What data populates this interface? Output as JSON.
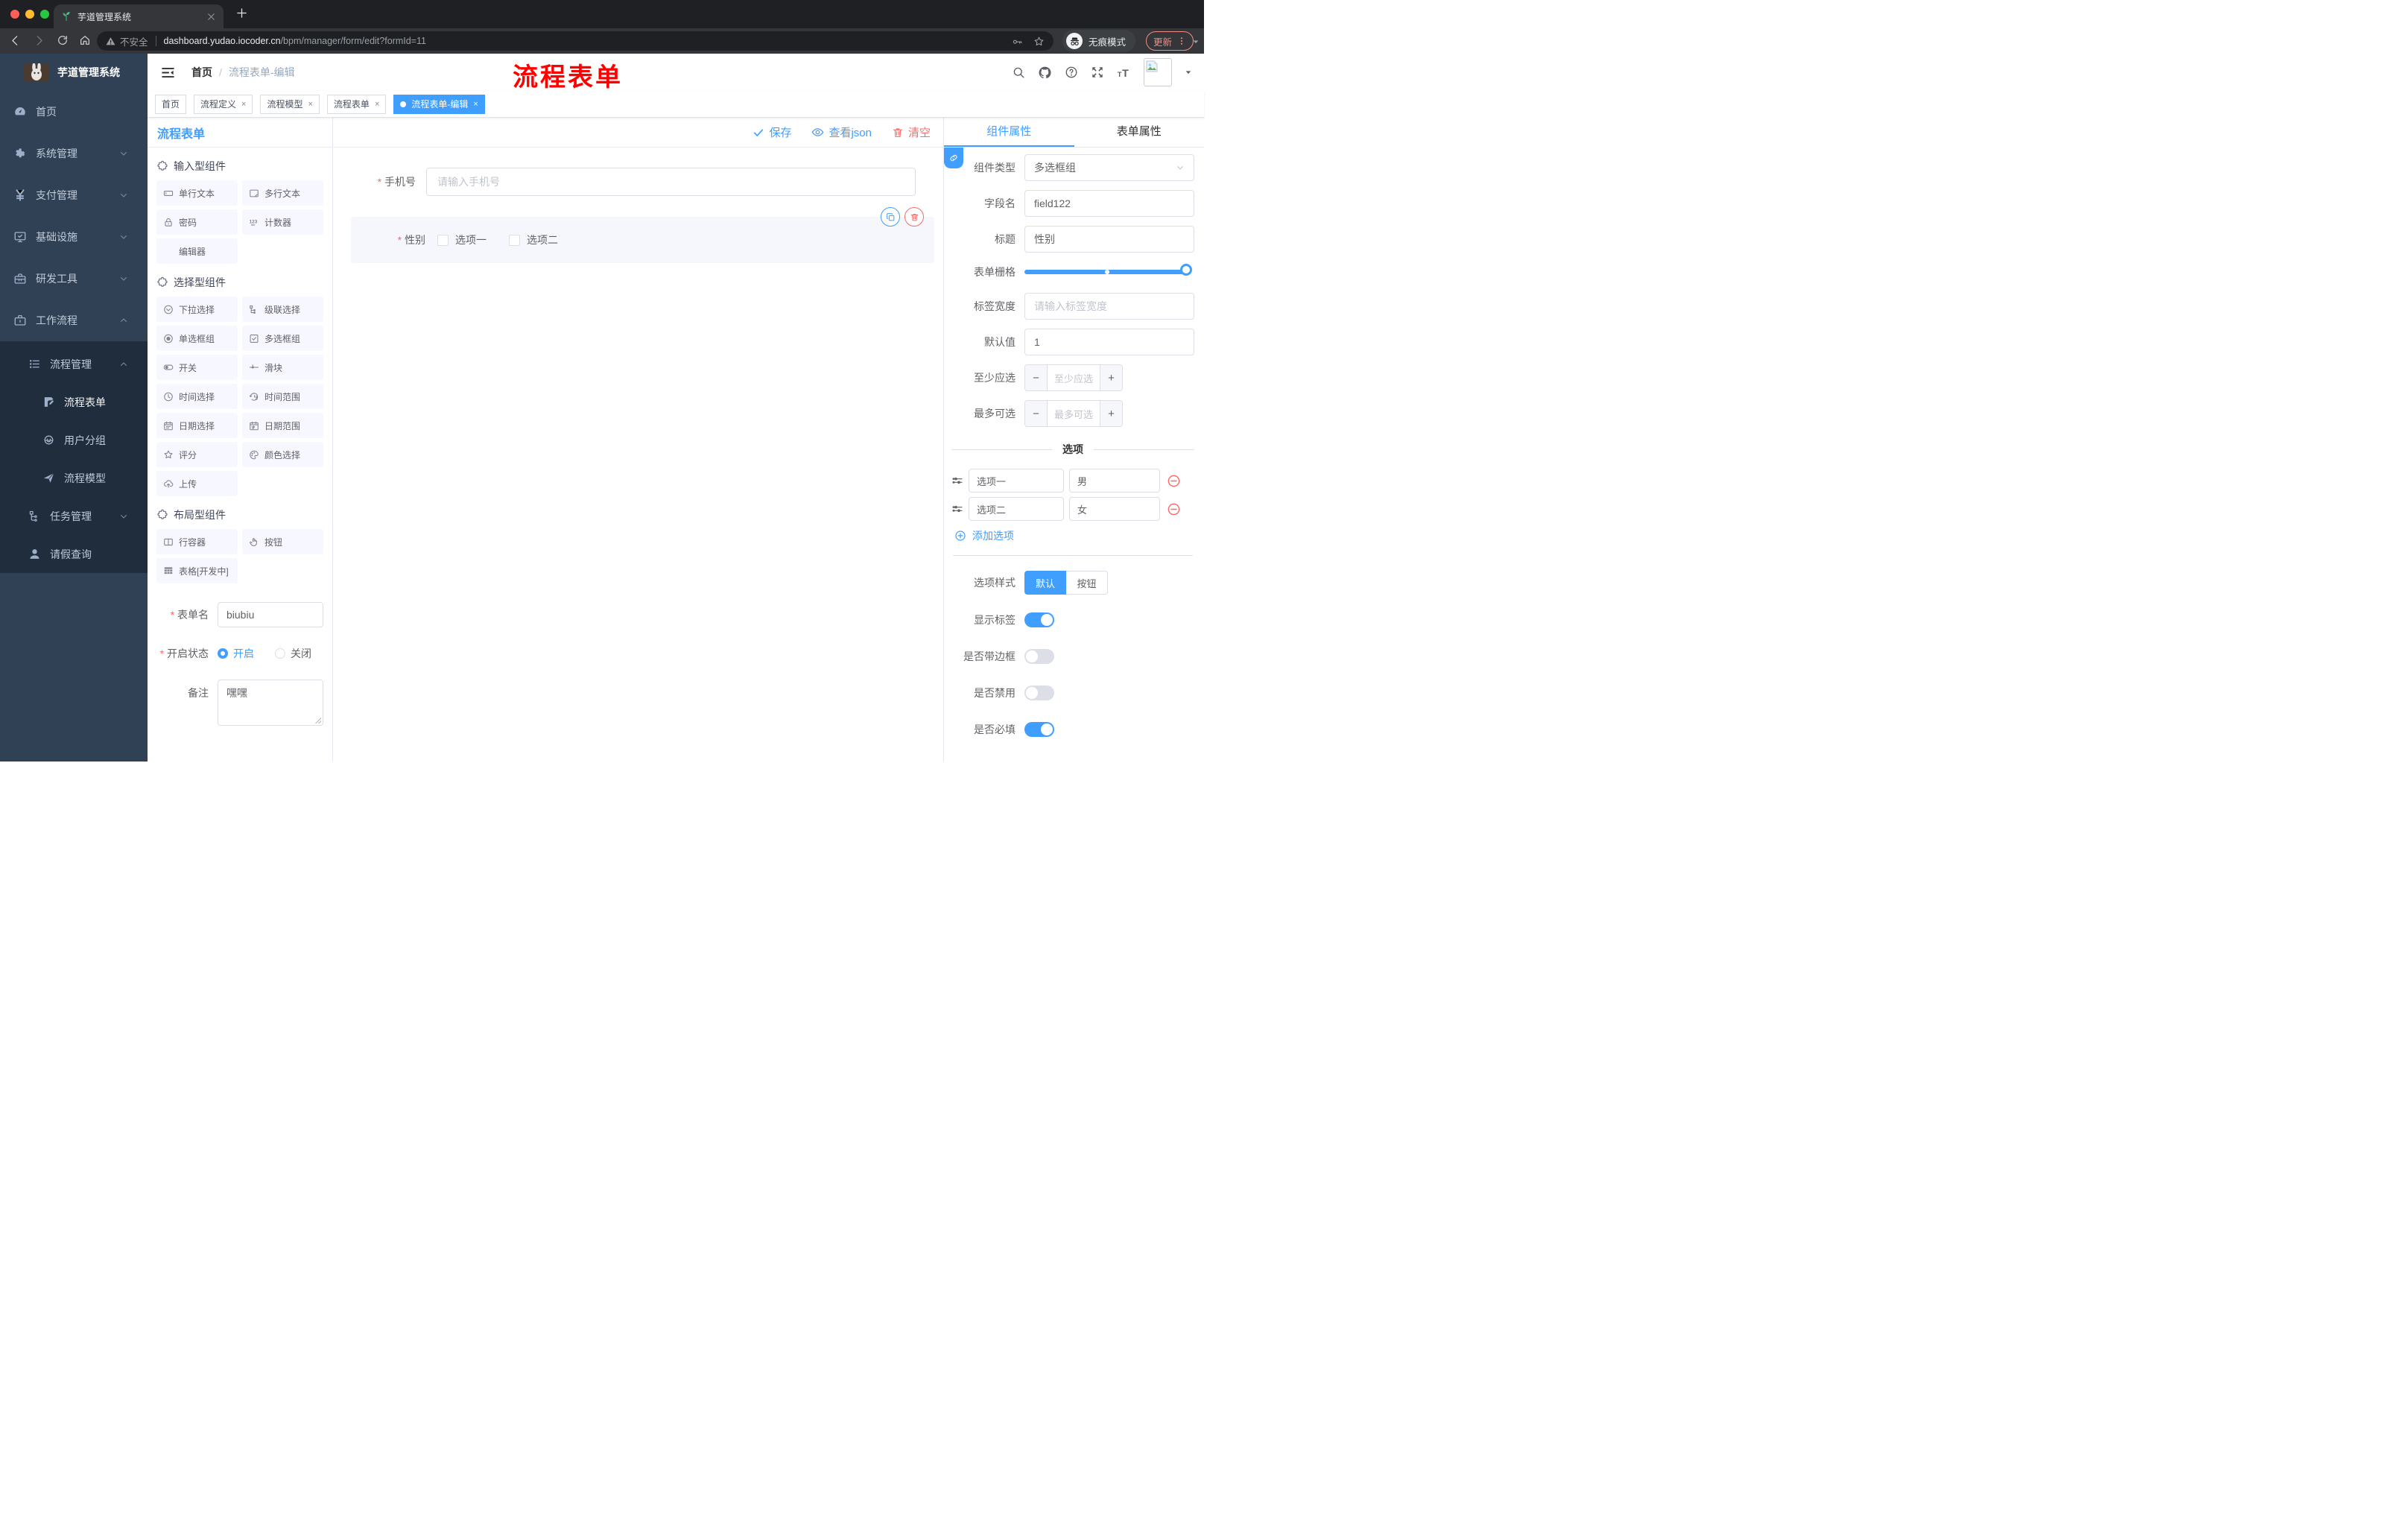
{
  "colors": {
    "accent": "#409eff",
    "danger": "#f56c6c",
    "watermark": "#ff0000",
    "sidebar_bg": "#304156",
    "submenu_bg": "#1f2d3d",
    "active_tag_bg": "#409eff"
  },
  "browser": {
    "tab_title": "芋道管理系统",
    "security_label": "不安全",
    "url_host": "dashboard.yudao.iocoder.cn",
    "url_path": "/bpm/manager/form/edit?formId=11",
    "incognito_label": "无痕模式",
    "update_label": "更新"
  },
  "sidebar": {
    "app_title": "芋道管理系统",
    "items": [
      {
        "label": "首页",
        "icon": "dashboard-icon",
        "chevron": null
      },
      {
        "label": "系统管理",
        "icon": "gear-icon",
        "chevron": "down"
      },
      {
        "label": "支付管理",
        "icon": "yen-icon",
        "chevron": "down"
      },
      {
        "label": "基础设施",
        "icon": "monitor-icon",
        "chevron": "down"
      },
      {
        "label": "研发工具",
        "icon": "toolbox-icon",
        "chevron": "down"
      },
      {
        "label": "工作流程",
        "icon": "briefcase-icon",
        "chevron": "up"
      }
    ],
    "submenu": [
      {
        "label": "流程管理",
        "icon": "list-tree-icon",
        "chevron": "up",
        "level": 2,
        "active": false
      },
      {
        "label": "流程表单",
        "icon": "form-doc-icon",
        "chevron": null,
        "level": 3,
        "active": true
      },
      {
        "label": "用户分组",
        "icon": "group-face-icon",
        "chevron": null,
        "level": 3,
        "active": false
      },
      {
        "label": "流程模型",
        "icon": "send-icon",
        "chevron": null,
        "level": 3,
        "active": false
      },
      {
        "label": "任务管理",
        "icon": "org-tree-icon",
        "chevron": "down",
        "level": 2,
        "active": false
      },
      {
        "label": "请假查询",
        "icon": "user-icon",
        "chevron": null,
        "level": 2,
        "active": false
      }
    ]
  },
  "header": {
    "breadcrumb_home": "首页",
    "breadcrumb_sep": "/",
    "breadcrumb_current": "流程表单-编辑",
    "watermark": "流程表单"
  },
  "tags": [
    {
      "label": "首页",
      "closable": false,
      "active": false
    },
    {
      "label": "流程定义",
      "closable": true,
      "active": false
    },
    {
      "label": "流程模型",
      "closable": true,
      "active": false
    },
    {
      "label": "流程表单",
      "closable": true,
      "active": false
    },
    {
      "label": "流程表单-编辑",
      "closable": true,
      "active": true
    }
  ],
  "designer": {
    "panel_title": "流程表单",
    "toolbar": {
      "save": "保存",
      "view_json": "查看json",
      "clear": "清空"
    },
    "sections": [
      {
        "title": "输入型组件",
        "items": [
          {
            "label": "单行文本",
            "icon": "input-icon"
          },
          {
            "label": "多行文本",
            "icon": "textarea-icon"
          },
          {
            "label": "密码",
            "icon": "lock-icon"
          },
          {
            "label": "计数器",
            "icon": "counter-icon"
          },
          {
            "label": "编辑器",
            "icon": null
          }
        ]
      },
      {
        "title": "选择型组件",
        "items": [
          {
            "label": "下拉选择",
            "icon": "select-icon"
          },
          {
            "label": "级联选择",
            "icon": "cascade-icon"
          },
          {
            "label": "单选框组",
            "icon": "radio-icon"
          },
          {
            "label": "多选框组",
            "icon": "checkbox-icon"
          },
          {
            "label": "开关",
            "icon": "switch-icon"
          },
          {
            "label": "滑块",
            "icon": "slider-icon"
          },
          {
            "label": "时间选择",
            "icon": "clock-icon"
          },
          {
            "label": "时间范围",
            "icon": "time-range-icon"
          },
          {
            "label": "日期选择",
            "icon": "calendar-icon"
          },
          {
            "label": "日期范围",
            "icon": "date-range-icon"
          },
          {
            "label": "评分",
            "icon": "star-icon"
          },
          {
            "label": "颜色选择",
            "icon": "palette-icon"
          },
          {
            "label": "上传",
            "icon": "upload-icon"
          }
        ]
      },
      {
        "title": "布局型组件",
        "items": [
          {
            "label": "行容器",
            "icon": "row-container-icon"
          },
          {
            "label": "按钮",
            "icon": "pointer-icon"
          },
          {
            "label": "表格[开发中]",
            "icon": "table-icon"
          }
        ]
      }
    ],
    "form": {
      "name_label": "表单名",
      "name_value": "biubiu",
      "status_label": "开启状态",
      "status_options": [
        {
          "label": "开启",
          "selected": true
        },
        {
          "label": "关闭",
          "selected": false
        }
      ],
      "remark_label": "备注",
      "remark_value": "嘿嘿"
    }
  },
  "canvas": {
    "phone_field": {
      "label": "手机号",
      "required": true,
      "placeholder": "请输入手机号"
    },
    "gender_field": {
      "label": "性别",
      "required": true,
      "options": [
        "选项一",
        "选项二"
      ]
    }
  },
  "inspector": {
    "tabs": [
      "组件属性",
      "表单属性"
    ],
    "active_tab": 0,
    "component_type": {
      "label": "组件类型",
      "value": "多选框组"
    },
    "field_name": {
      "label": "字段名",
      "value": "field122"
    },
    "title_field": {
      "label": "标题",
      "value": "性别"
    },
    "grid": {
      "label": "表单栅格"
    },
    "label_width": {
      "label": "标签宽度",
      "placeholder": "请输入标签宽度"
    },
    "default_value": {
      "label": "默认值",
      "value": "1"
    },
    "min_select": {
      "label": "至少应选",
      "placeholder": "至少应选"
    },
    "max_select": {
      "label": "最多可选",
      "placeholder": "最多可选"
    },
    "options_divider": "选项",
    "options": [
      {
        "label": "选项一",
        "value": "男"
      },
      {
        "label": "选项二",
        "value": "女"
      }
    ],
    "add_option": "添加选项",
    "option_style": {
      "label": "选项样式",
      "choices": [
        "默认",
        "按钮"
      ],
      "active": 0
    },
    "switches": [
      {
        "label": "显示标签",
        "on": true
      },
      {
        "label": "是否带边框",
        "on": false
      },
      {
        "label": "是否禁用",
        "on": false
      },
      {
        "label": "是否必填",
        "on": true
      }
    ]
  }
}
